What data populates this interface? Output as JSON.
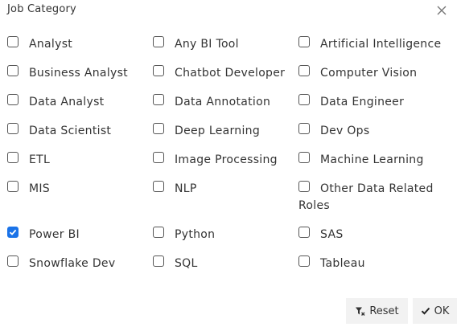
{
  "dialog": {
    "title": "Job Category",
    "close_icon": "close-icon"
  },
  "categories": [
    {
      "label": "Analyst",
      "checked": false
    },
    {
      "label": "Any BI Tool",
      "checked": false
    },
    {
      "label": "Artificial Intelligence",
      "checked": false
    },
    {
      "label": "Business Analyst",
      "checked": false
    },
    {
      "label": "Chatbot Developer",
      "checked": false
    },
    {
      "label": "Computer Vision",
      "checked": false
    },
    {
      "label": "Data Analyst",
      "checked": false
    },
    {
      "label": "Data Annotation",
      "checked": false
    },
    {
      "label": "Data Engineer",
      "checked": false
    },
    {
      "label": "Data Scientist",
      "checked": false
    },
    {
      "label": "Deep Learning",
      "checked": false
    },
    {
      "label": "Dev Ops",
      "checked": false
    },
    {
      "label": "ETL",
      "checked": false
    },
    {
      "label": "Image Processing",
      "checked": false
    },
    {
      "label": "Machine Learning",
      "checked": false
    },
    {
      "label": "MIS",
      "checked": false
    },
    {
      "label": "NLP",
      "checked": false
    },
    {
      "label": "Other Data Related Roles",
      "checked": false
    },
    {
      "label": "Power BI",
      "checked": true
    },
    {
      "label": "Python",
      "checked": false
    },
    {
      "label": "SAS",
      "checked": false
    },
    {
      "label": "Snowflake Dev",
      "checked": false
    },
    {
      "label": "SQL",
      "checked": false
    },
    {
      "label": "Tableau",
      "checked": false
    }
  ],
  "buttons": {
    "reset_label": "Reset",
    "reset_icon": "filter-reset-icon",
    "ok_label": "OK",
    "ok_icon": "checkmark-icon"
  },
  "colors": {
    "checked_fill": "#1a73e8",
    "button_bg": "#f2f2f2",
    "text": "#333333"
  }
}
